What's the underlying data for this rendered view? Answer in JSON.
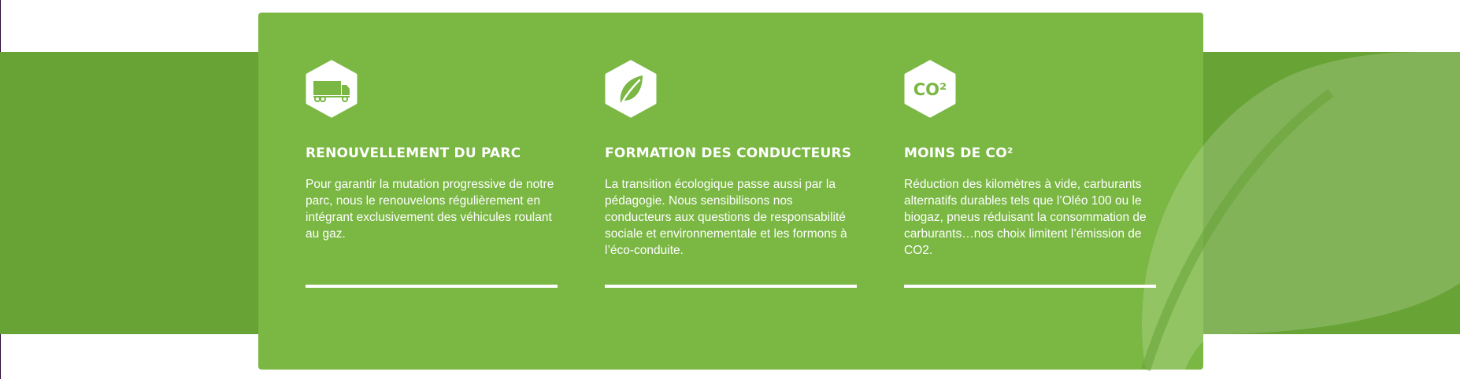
{
  "colors": {
    "band": "#68a335",
    "card": "#7ab743",
    "text": "#ffffff"
  },
  "features": [
    {
      "icon": "truck-icon",
      "title": "RENOUVELLEMENT DU PARC",
      "text": "Pour garantir la mutation progressive de notre parc, nous le renouvelons régulièrement en intégrant exclusivement des véhicules roulant au gaz."
    },
    {
      "icon": "leaf-icon",
      "title": "FORMATION DES CONDUCTEURS",
      "text": "La transition écologique passe aussi par la pédagogie. Nous sensibilisons nos conducteurs aux questions de responsabilité sociale et environnementale et les formons à l’éco-conduite."
    },
    {
      "icon": "co2-icon",
      "icon_text": "CO²",
      "title": "MOINS DE CO²",
      "text": "Réduction des kilomètres à vide, carburants alternatifs durables tels que l’Oléo 100 ou le biogaz, pneus réduisant la consommation de carburants…nos choix limitent l’émission de CO2."
    }
  ]
}
